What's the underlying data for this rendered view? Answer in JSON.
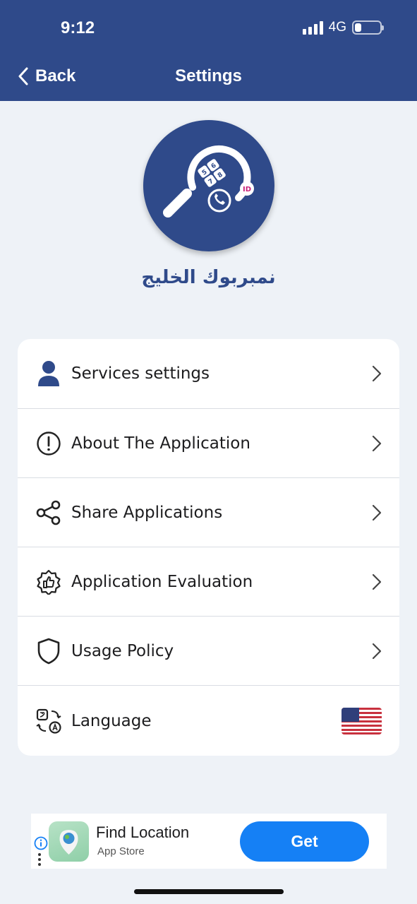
{
  "status_bar": {
    "time": "9:12",
    "network": "4G"
  },
  "nav": {
    "back_label": "Back",
    "title": "Settings"
  },
  "app": {
    "name": "نمبربوك الخليج",
    "logo_badge": "ID",
    "logo_keys": [
      "5",
      "6",
      "7",
      "8"
    ]
  },
  "menu": {
    "items": [
      {
        "label": "Services settings",
        "icon": "user-icon"
      },
      {
        "label": "About The Application",
        "icon": "info-circle-icon"
      },
      {
        "label": "Share Applications",
        "icon": "share-icon"
      },
      {
        "label": "Application Evaluation",
        "icon": "thumbs-up-badge-icon"
      },
      {
        "label": "Usage Policy",
        "icon": "shield-icon"
      },
      {
        "label": "Language",
        "icon": "translate-icon",
        "value_icon": "us-flag-icon"
      }
    ]
  },
  "ad": {
    "title": "Find Location",
    "subtitle": "App Store",
    "cta": "Get"
  },
  "colors": {
    "primary": "#2f4a8a",
    "background": "#eef2f7",
    "ad_button": "#1580f5"
  }
}
